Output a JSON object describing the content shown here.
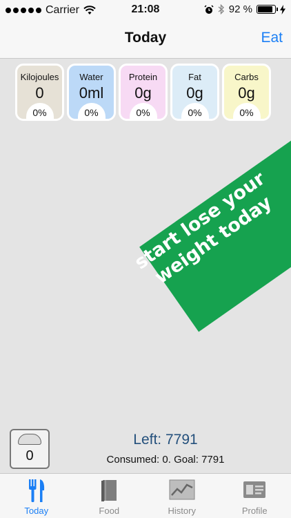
{
  "status": {
    "carrier": "Carrier",
    "time": "21:08",
    "battery": "92 %",
    "battery_level": 0.92,
    "icons": [
      "signal-dots-icon",
      "wifi-icon",
      "alarm-icon",
      "bluetooth-icon",
      "battery-icon",
      "charging-icon"
    ]
  },
  "nav": {
    "title": "Today",
    "right_action": "Eat"
  },
  "stats": [
    {
      "label": "Kilojoules",
      "value": "0",
      "percent": "0%",
      "color": "#e6e1d6"
    },
    {
      "label": "Water",
      "value": "0ml",
      "percent": "0%",
      "color": "#bcd9f7"
    },
    {
      "label": "Protein",
      "value": "0g",
      "percent": "0%",
      "color": "#f7daf4"
    },
    {
      "label": "Fat",
      "value": "0g",
      "percent": "0%",
      "color": "#dcecf7"
    },
    {
      "label": "Carbs",
      "value": "0g",
      "percent": "0%",
      "color": "#f8f6c9"
    }
  ],
  "banner": {
    "line1": "start lose your",
    "line2": "weight today",
    "color": "#16a24f"
  },
  "summary": {
    "scale_value": "0",
    "left": "Left: 7791",
    "consumed": "Consumed: 0.  Goal: 7791"
  },
  "tabs": [
    {
      "label": "Today",
      "icon": "fork-knife-icon",
      "active": true
    },
    {
      "label": "Food",
      "icon": "book-icon",
      "active": false
    },
    {
      "label": "History",
      "icon": "chart-line-icon",
      "active": false
    },
    {
      "label": "Profile",
      "icon": "profile-card-icon",
      "active": false
    }
  ],
  "colors": {
    "accent": "#1b7ff5",
    "summary_text": "#24507c"
  }
}
